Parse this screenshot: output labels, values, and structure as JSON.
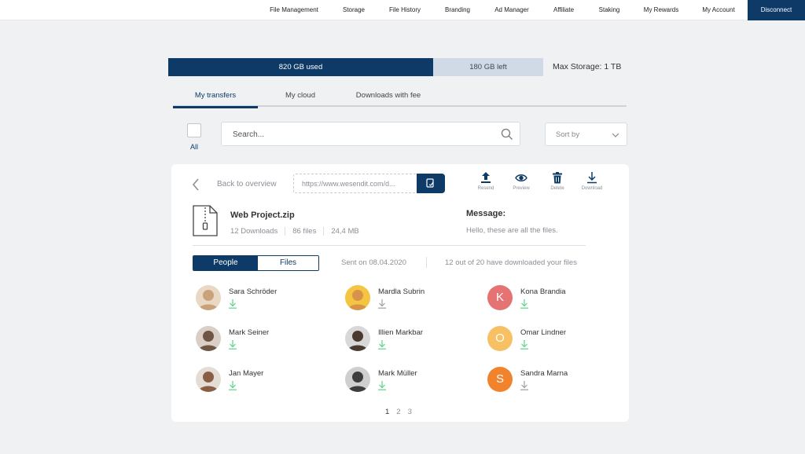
{
  "nav": {
    "items": [
      "File Management",
      "Storage",
      "File History",
      "Branding",
      "Ad Manager",
      "Affiliate",
      "Staking",
      "My Rewards",
      "My Account"
    ],
    "disconnect": "Disconnect"
  },
  "storage": {
    "used_label": "820 GB used",
    "left_label": "180 GB left",
    "used_fraction": 0.82,
    "max_label": "Max Storage: 1 TB",
    "colors": {
      "used": "#0d3a66",
      "left": "#d0dae6"
    }
  },
  "tabs": [
    "My transfers",
    "My cloud",
    "Downloads with fee"
  ],
  "controls": {
    "all_label": "All",
    "search_placeholder": "Search...",
    "sort_label": "Sort by",
    "icons": {
      "search": "search-icon",
      "sort": "chevron-down-icon"
    }
  },
  "transfer": {
    "back_label": "Back to overview",
    "link_url": "https://www.wesendit.com/d...",
    "actions": [
      "Resend",
      "Preview",
      "Delete",
      "Download"
    ],
    "file": {
      "name": "Web Project.zip",
      "downloads": "12 Downloads",
      "files": "86 files",
      "size": "24,4 MB"
    },
    "message_title": "Message:",
    "message_text": "Hello, these are all the files.",
    "view_toggle": [
      "People",
      "Files"
    ],
    "sent_on": "Sent on 08.04.2020",
    "download_status": "12 out of 20 have downloaded your files",
    "people": [
      {
        "name": "Sara Schröder",
        "downloaded": true
      },
      {
        "name": "Mardla Subrin",
        "downloaded": false
      },
      {
        "name": "Kona Brandia",
        "initial": "K",
        "color": "#e57373",
        "downloaded": true
      },
      {
        "name": "Mark Seiner",
        "downloaded": true
      },
      {
        "name": "Illien Markbar",
        "downloaded": true
      },
      {
        "name": "Omar Lindner",
        "initial": "O",
        "color": "#f6c063",
        "downloaded": true
      },
      {
        "name": "Jan Mayer",
        "downloaded": true
      },
      {
        "name": "Mark Müller",
        "downloaded": true
      },
      {
        "name": "Sandra Marna",
        "initial": "S",
        "color": "#f0832c",
        "downloaded": false
      }
    ],
    "pages": [
      "1",
      "2",
      "3"
    ],
    "colors": {
      "accent": "#0d3a66",
      "downloaded": "#5fd28a",
      "not_downloaded": "#9aa0a6"
    }
  }
}
